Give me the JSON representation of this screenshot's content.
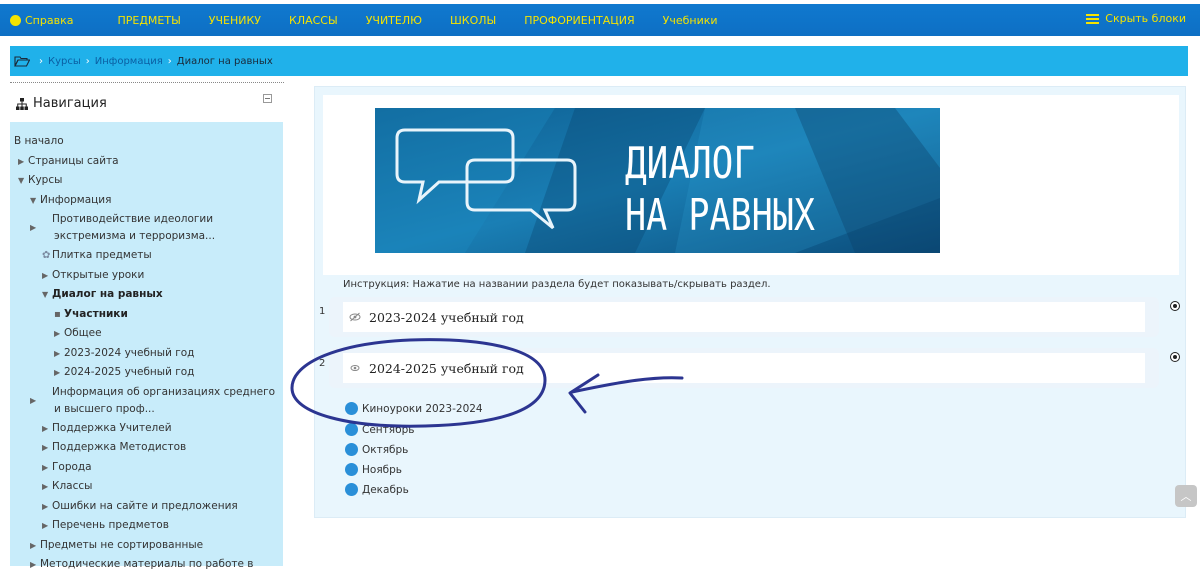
{
  "topbar": {
    "help": "Справка",
    "menu": [
      "ПРЕДМЕТЫ",
      "УЧЕНИКУ",
      "КЛАССЫ",
      "УЧИТЕЛЮ",
      "ШКОЛЫ",
      "ПРОФОРИЕНТАЦИЯ",
      "Учебники"
    ],
    "hide_blocks": "Скрыть блоки"
  },
  "breadcrumb": {
    "items": [
      "Курсы",
      "Информация",
      "Диалог на равных"
    ]
  },
  "navigation": {
    "title": "Навигация",
    "home": "В начало",
    "site_pages": "Страницы сайта",
    "courses": "Курсы",
    "info": "Информация",
    "extremism": "Противодействие идеологии экстремизма и терроризма...",
    "tile": "Плитка предметы",
    "open_lessons": "Открытые уроки",
    "dialog": "Диалог на равных",
    "participants": "Участники",
    "general": "Общее",
    "year1": "2023-2024 учебный год",
    "year2": "2024-2025 учебный год",
    "orgs": "Информация об организациях среднего и высшего проф...",
    "teacher_support": "Поддержка Учителей",
    "methodist_support": "Поддержка Методистов",
    "cities": "Города",
    "classes": "Классы",
    "errors": "Ошибки на сайте и предложения",
    "subjects_list": "Перечень предметов",
    "unsorted": "Предметы не сортированные",
    "methodical": "Методические материалы по работе в"
  },
  "banner": {
    "line1": "ДИАЛОГ",
    "line2": "НА РАВНЫХ"
  },
  "main": {
    "instruction": "Инструкция: Нажатие на названии раздела будет показывать/скрывать раздел.",
    "sections": [
      {
        "num": "1",
        "title": "2023-2024 учебный год"
      },
      {
        "num": "2",
        "title": "2024-2025 учебный год"
      }
    ],
    "links": [
      "Киноуроки 2023-2024",
      "Сентябрь",
      "Октябрь",
      "Ноябрь",
      "Декабрь"
    ]
  },
  "colors": {
    "topbar": "#0d6fc4",
    "menu_text": "#f5e300",
    "breadcrumb_bg": "#20b1ea",
    "nav_bg": "#c8ecfa",
    "annotation": "#2c3591"
  }
}
